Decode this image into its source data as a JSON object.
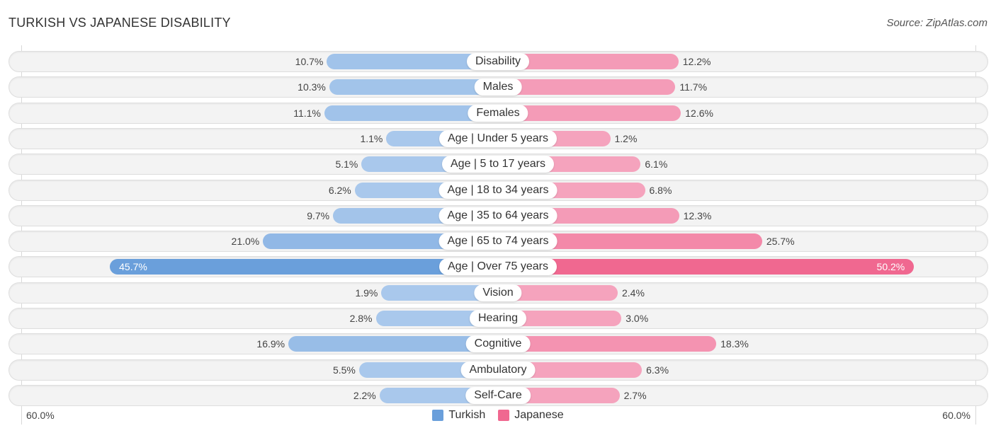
{
  "header": {
    "title": "TURKISH VS JAPANESE DISABILITY",
    "source": "Source: ZipAtlas.com"
  },
  "colors": {
    "turkish": "#6a9fdb",
    "japanese": "#f06890",
    "turkish_light": "#a9c8ec",
    "japanese_light": "#f5a3bd"
  },
  "chart_data": {
    "type": "bar",
    "orientation": "horizontal-diverging",
    "title": "TURKISH VS JAPANESE DISABILITY",
    "categories": [
      "Disability",
      "Males",
      "Females",
      "Age | Under 5 years",
      "Age | 5 to 17 years",
      "Age | 18 to 34 years",
      "Age | 35 to 64 years",
      "Age | 65 to 74 years",
      "Age | Over 75 years",
      "Vision",
      "Hearing",
      "Cognitive",
      "Ambulatory",
      "Self-Care"
    ],
    "series": [
      {
        "name": "Turkish",
        "side": "left",
        "values": [
          10.7,
          10.3,
          11.1,
          1.1,
          5.1,
          6.2,
          9.7,
          21.0,
          45.7,
          1.9,
          2.8,
          16.9,
          5.5,
          2.2
        ],
        "labels": [
          "10.7%",
          "10.3%",
          "11.1%",
          "1.1%",
          "5.1%",
          "6.2%",
          "9.7%",
          "21.0%",
          "45.7%",
          "1.9%",
          "2.8%",
          "16.9%",
          "5.5%",
          "2.2%"
        ]
      },
      {
        "name": "Japanese",
        "side": "right",
        "values": [
          12.2,
          11.7,
          12.6,
          1.2,
          6.1,
          6.8,
          12.3,
          25.7,
          50.2,
          2.4,
          3.0,
          18.3,
          6.3,
          2.7
        ],
        "labels": [
          "12.2%",
          "11.7%",
          "12.6%",
          "1.2%",
          "6.1%",
          "6.8%",
          "12.3%",
          "25.7%",
          "50.2%",
          "2.4%",
          "3.0%",
          "18.3%",
          "6.3%",
          "2.7%"
        ]
      }
    ],
    "axis": {
      "min_label": "60.0%",
      "max_label": "60.0%",
      "range": [
        0,
        60
      ]
    },
    "legend": {
      "position": "bottom-center",
      "entries": [
        "Turkish",
        "Japanese"
      ]
    },
    "grid": true
  }
}
